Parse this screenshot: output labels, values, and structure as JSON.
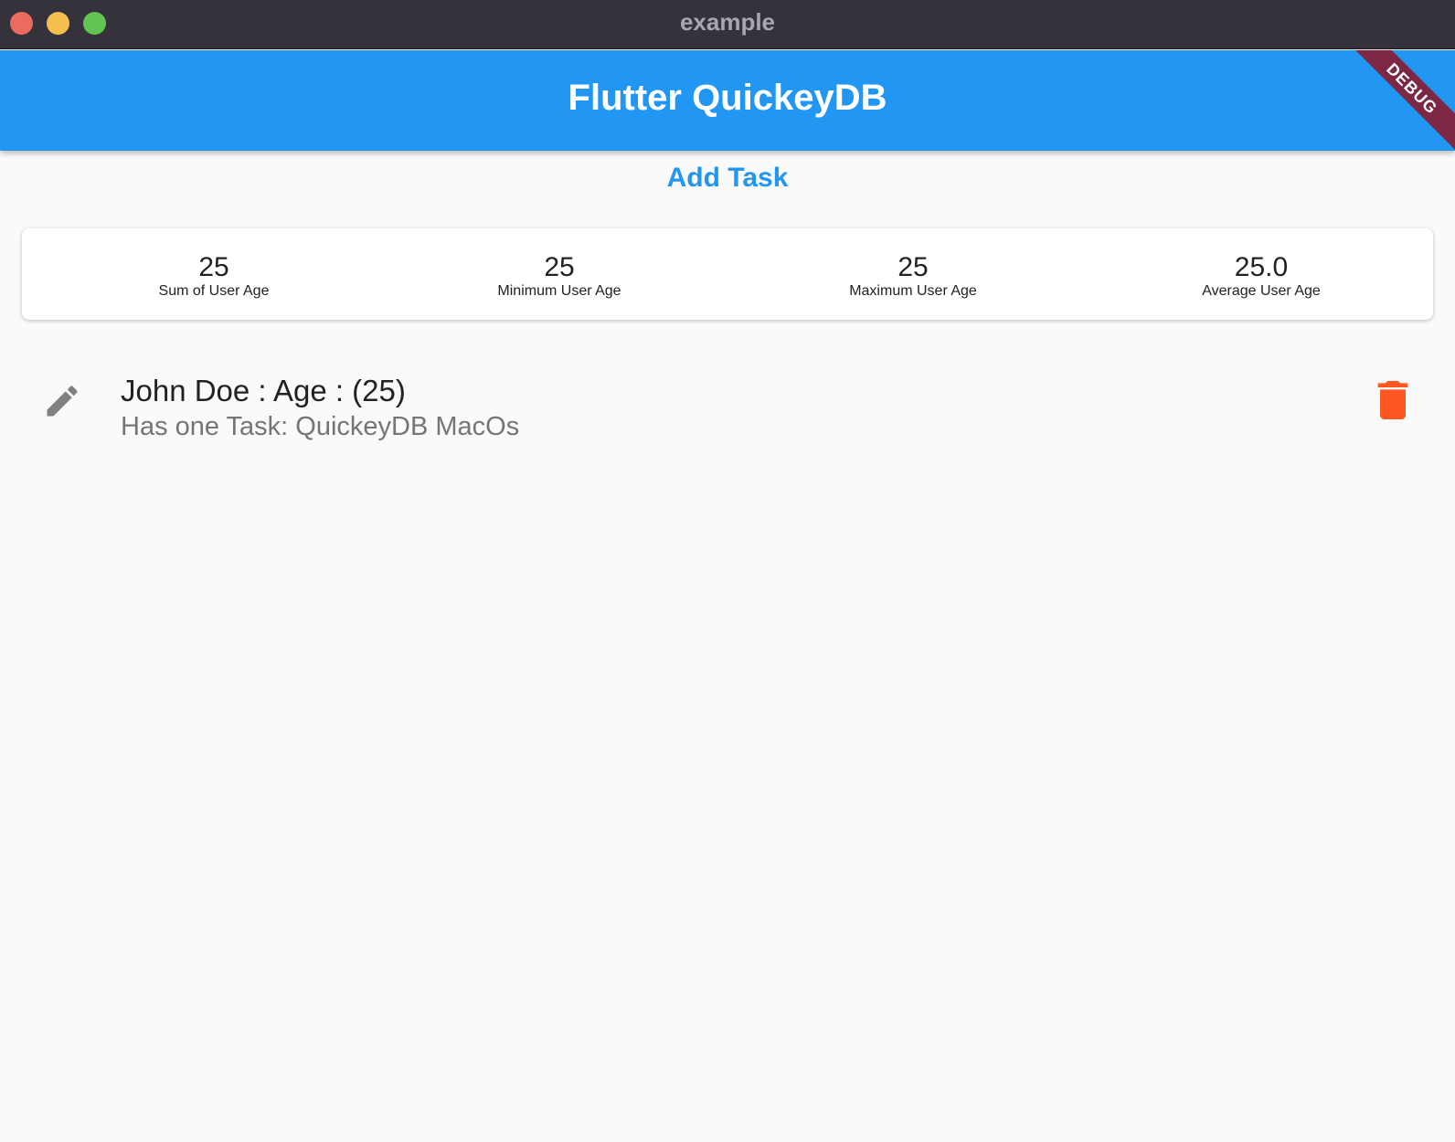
{
  "window": {
    "title": "example"
  },
  "appbar": {
    "title": "Flutter QuickeyDB",
    "debug_banner": "DEBUG",
    "color": "#2196f3"
  },
  "actions": {
    "add_task_label": "Add Task"
  },
  "stats": [
    {
      "value": "25",
      "label": "Sum of User Age"
    },
    {
      "value": "25",
      "label": "Minimum User Age"
    },
    {
      "value": "25",
      "label": "Maximum User Age"
    },
    {
      "value": "25.0",
      "label": "Average User Age"
    }
  ],
  "users": [
    {
      "title": "John Doe : Age : (25)",
      "subtitle": "Has one Task: QuickeyDB MacOs",
      "leading_icon": "edit-icon",
      "trailing_icon": "delete-icon",
      "delete_color": "#ff5722"
    }
  ]
}
